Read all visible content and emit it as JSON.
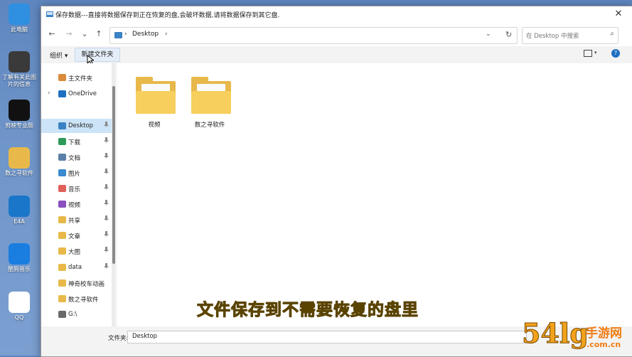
{
  "desktop": {
    "icons": [
      {
        "label": "此电脑",
        "icon": "computer-icon",
        "color": "#2f8fe0"
      },
      {
        "label": "了解有关此图片的信息",
        "icon": "info-icon",
        "color": "#3a3a3a"
      },
      {
        "label": "剪映专业版",
        "icon": "capcut-icon",
        "color": "#111111"
      },
      {
        "label": "数之寻软件",
        "icon": "folder-icon",
        "color": "#e8b94a"
      },
      {
        "label": "E4A",
        "icon": "e4a-icon",
        "color": "#1a76c9"
      },
      {
        "label": "酷狗音乐",
        "icon": "kugou-icon",
        "color": "#1a7de0"
      },
      {
        "label": "QQ",
        "icon": "qq-icon",
        "color": "#ffffff"
      }
    ]
  },
  "dialog": {
    "title": "保存数据---直接将数据保存到正在恢复的盘,会破坏数据,请将数据保存到其它盘.",
    "close_glyph": "✕",
    "nav_back": "←",
    "nav_forward": "→",
    "nav_recent": "⌄",
    "nav_up": "↑",
    "path_sep": "›",
    "path_current": "Desktop",
    "path_sep_end": "›",
    "path_dropdown": "⌄",
    "refresh_glyph": "↻",
    "search_placeholder": "在 Desktop 中搜索",
    "search_glyph": "⌕"
  },
  "toolbar": {
    "organize_label": "组织 ▾",
    "new_folder_label": "新建文件夹",
    "view_dropdown": "▾",
    "help_glyph": "?"
  },
  "sidebar": {
    "items": [
      {
        "label": "主文件夹",
        "icon": "home-icon",
        "color": "#d98a3a",
        "pinned": false,
        "expand": ""
      },
      {
        "label": "OneDrive",
        "icon": "onedrive-icon",
        "color": "#1f6fc1",
        "pinned": false,
        "expand": "›"
      },
      {
        "label": "Desktop",
        "icon": "desktop-icon",
        "color": "#3b82c4",
        "pinned": true,
        "expand": "",
        "selected": true
      },
      {
        "label": "下载",
        "icon": "download-icon",
        "color": "#2e9a5a",
        "pinned": true,
        "expand": ""
      },
      {
        "label": "文档",
        "icon": "documents-icon",
        "color": "#5c7fa8",
        "pinned": true,
        "expand": ""
      },
      {
        "label": "图片",
        "icon": "pictures-icon",
        "color": "#3a8ad0",
        "pinned": true,
        "expand": ""
      },
      {
        "label": "音乐",
        "icon": "music-icon",
        "color": "#e0605a",
        "pinned": true,
        "expand": ""
      },
      {
        "label": "视频",
        "icon": "videos-icon",
        "color": "#8a4fc0",
        "pinned": true,
        "expand": ""
      },
      {
        "label": "共享",
        "icon": "folder-icon",
        "color": "#e8b94a",
        "pinned": true,
        "expand": ""
      },
      {
        "label": "文章",
        "icon": "folder-icon",
        "color": "#e8b94a",
        "pinned": true,
        "expand": ""
      },
      {
        "label": "大图",
        "icon": "folder-icon",
        "color": "#e8b94a",
        "pinned": true,
        "expand": ""
      },
      {
        "label": "data",
        "icon": "folder-icon",
        "color": "#e8b94a",
        "pinned": true,
        "expand": ""
      },
      {
        "label": "神奇校车动画",
        "icon": "folder-icon",
        "color": "#e8b94a",
        "pinned": false,
        "expand": ""
      },
      {
        "label": "数之寻软件",
        "icon": "folder-icon",
        "color": "#e8b94a",
        "pinned": false,
        "expand": ""
      },
      {
        "label": "G:\\",
        "icon": "drive-icon",
        "color": "#6a6a6a",
        "pinned": false,
        "expand": ""
      }
    ],
    "pin_glyph": "📌"
  },
  "files": [
    {
      "name": "视频",
      "icon": "folder-icon"
    },
    {
      "name": "数之寻软件",
      "icon": "folder-icon"
    }
  ],
  "footer": {
    "filename_label": "文件夹:",
    "filename_value": "Desktop"
  },
  "overlay": {
    "subtitle": "文件保存到不需要恢复的盘里",
    "watermark_number": "54lg",
    "watermark_cn": "手游网",
    "watermark_url": ".com.cn"
  },
  "colors": {
    "accent": "#1f6fc1",
    "selected_bg": "#cce4f7",
    "subtitle": "#f7e226",
    "watermark": "#f07d14"
  }
}
